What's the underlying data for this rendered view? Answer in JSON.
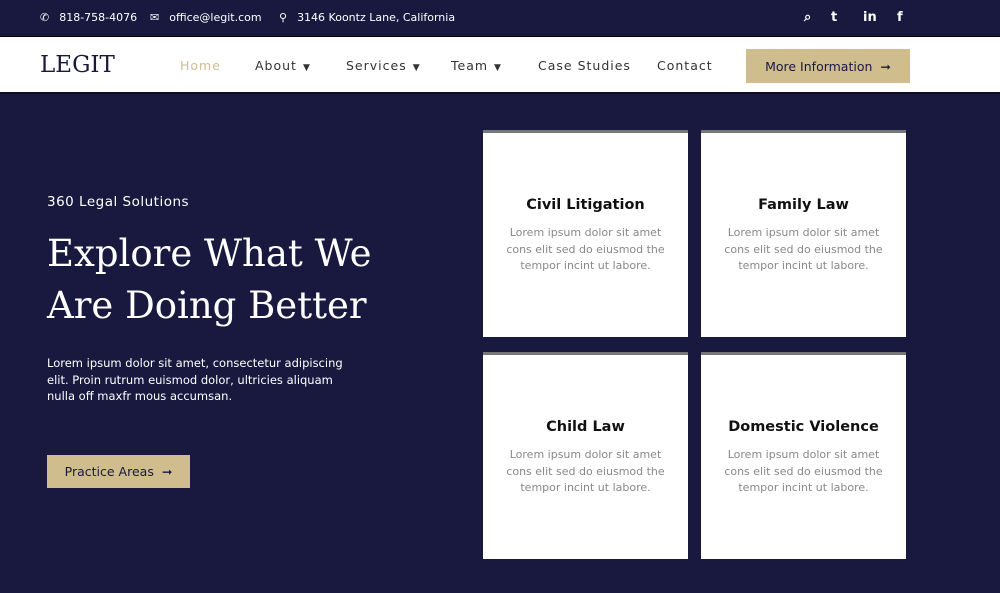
{
  "topbar": {
    "phone": "818-758-4076",
    "email": "office@legit.com",
    "address": "3146 Koontz Lane, California",
    "social": [
      "search-icon",
      "twitter-icon",
      "linkedin-icon",
      "facebook-icon"
    ]
  },
  "nav": {
    "logo": "LEGIT",
    "items": [
      {
        "label": "Home",
        "active": true
      },
      {
        "label": "About",
        "dropdown": true
      },
      {
        "label": "Services",
        "dropdown": true
      },
      {
        "label": "Team",
        "dropdown": true
      },
      {
        "label": "Case Studies"
      },
      {
        "label": "Contact"
      }
    ],
    "cta": "More Information"
  },
  "hero": {
    "subtitle": "360 Legal Solutions",
    "title": "Explore What We Are Doing Better",
    "text": "Lorem ipsum dolor sit amet, consectetur adipiscing elit. Proin rutrum euismod dolor, ultricies aliquam nulla off maxfr mous accumsan.",
    "button": "Practice Areas"
  },
  "cards": [
    {
      "title": "Civil Litigation",
      "text": "Lorem ipsum dolor sit amet cons elit sed do eiusmod the tempor incint ut labore."
    },
    {
      "title": "Family Law",
      "text": "Lorem ipsum dolor sit amet cons elit sed do eiusmod the tempor incint ut labore."
    },
    {
      "title": "Child Law",
      "text": "Lorem ipsum dolor sit amet cons elit sed do eiusmod the tempor incint ut labore."
    },
    {
      "title": "Domestic Violence",
      "text": "Lorem ipsum dolor sit amet cons elit sed do eiusmod the tempor incint ut labore."
    }
  ],
  "colors": {
    "navy": "#191940",
    "gold": "#cfbd8e"
  }
}
